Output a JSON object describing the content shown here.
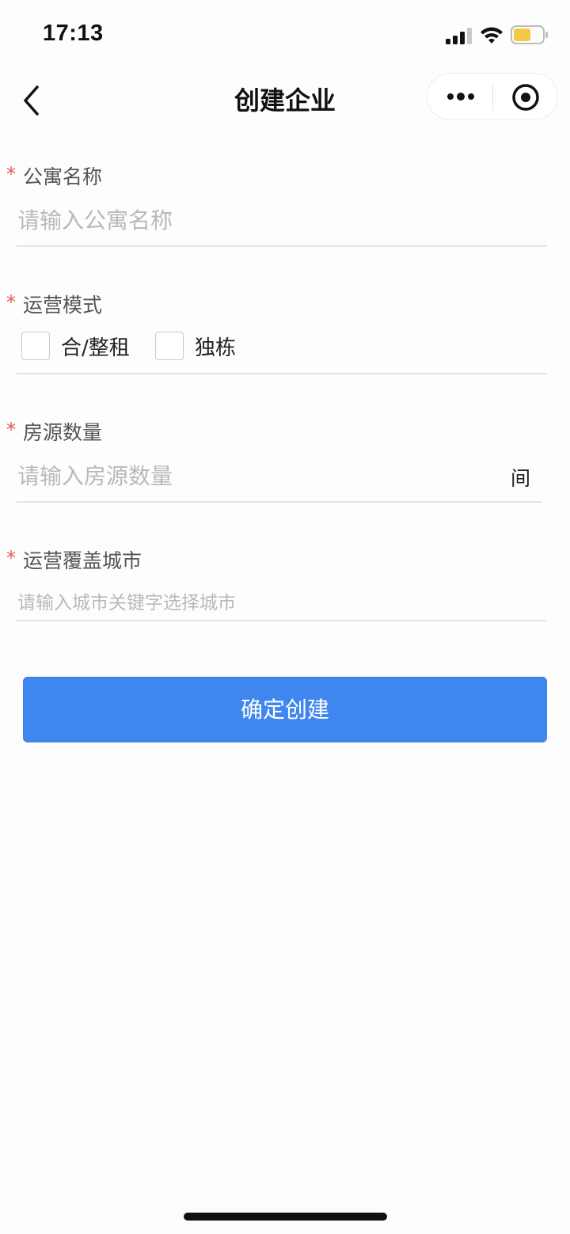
{
  "status_bar": {
    "time": "17:13"
  },
  "nav": {
    "title": "创建企业"
  },
  "form": {
    "apartment_name": {
      "label": "公寓名称",
      "required_mark": "*",
      "placeholder": "请输入公寓名称",
      "value": ""
    },
    "operation_mode": {
      "label": "运营模式",
      "required_mark": "*",
      "options": [
        {
          "label": "合/整租",
          "checked": false
        },
        {
          "label": "独栋",
          "checked": false
        }
      ]
    },
    "room_count": {
      "label": "房源数量",
      "required_mark": "*",
      "placeholder": "请输入房源数量",
      "value": "",
      "unit": "间"
    },
    "coverage_city": {
      "label": "运营覆盖城市",
      "required_mark": "*",
      "placeholder": "请输入城市关键字选择城市",
      "value": ""
    },
    "submit_label": "确定创建"
  },
  "colors": {
    "primary_button": "#3f86ef",
    "required_star": "#e35b4f",
    "battery_fill": "#f6c944"
  }
}
